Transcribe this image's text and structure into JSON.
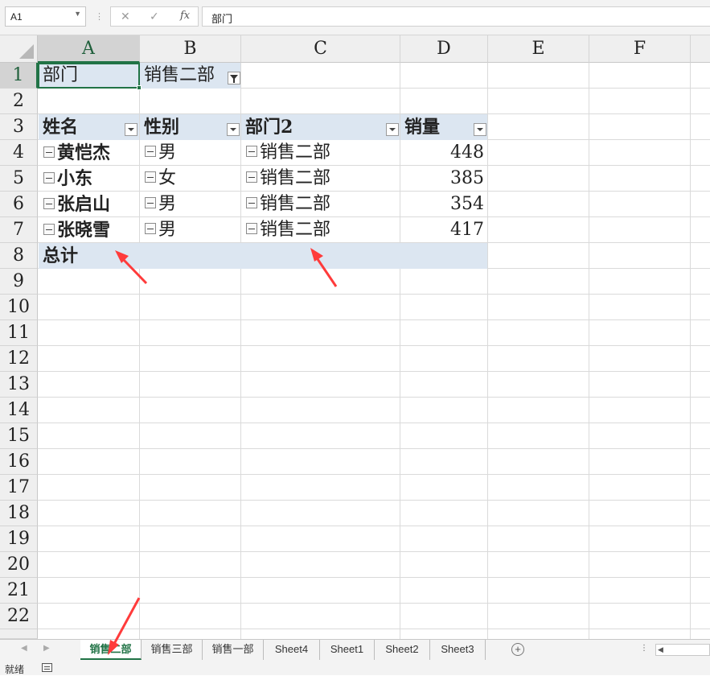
{
  "formula_bar": {
    "name_box": "A1",
    "dots": "⋮",
    "cancel_glyph": "✕",
    "enter_glyph": "✓",
    "fx_label": "fx",
    "content": "部门"
  },
  "columns": [
    "A",
    "B",
    "C",
    "D",
    "E",
    "F"
  ],
  "rows": [
    "1",
    "2",
    "3",
    "4",
    "5",
    "6",
    "7",
    "8",
    "9",
    "10",
    "11",
    "12",
    "13",
    "14",
    "15",
    "16",
    "17",
    "18",
    "19",
    "20",
    "21",
    "22"
  ],
  "pivot": {
    "filter_label": "部门",
    "filter_value": "销售二部",
    "headers": [
      "姓名",
      "性别",
      "部门2",
      "销量"
    ],
    "records": [
      {
        "name": "黄恺杰",
        "gender": "男",
        "dept": "销售二部",
        "sales": "448"
      },
      {
        "name": "小东",
        "gender": "女",
        "dept": "销售二部",
        "sales": "385"
      },
      {
        "name": "张启山",
        "gender": "男",
        "dept": "销售二部",
        "sales": "354"
      },
      {
        "name": "张晓雪",
        "gender": "男",
        "dept": "销售二部",
        "sales": "417"
      }
    ],
    "total_label": "总计"
  },
  "sheet_tabs": [
    "销售二部",
    "销售三部",
    "销售一部",
    "Sheet4",
    "Sheet1",
    "Sheet2",
    "Sheet3"
  ],
  "active_tab": "销售二部",
  "status": {
    "text": "就绪"
  },
  "colors": {
    "accent": "#217346",
    "pivot_header": "#dce6f1",
    "annotation_arrow": "#ff3b3b"
  }
}
